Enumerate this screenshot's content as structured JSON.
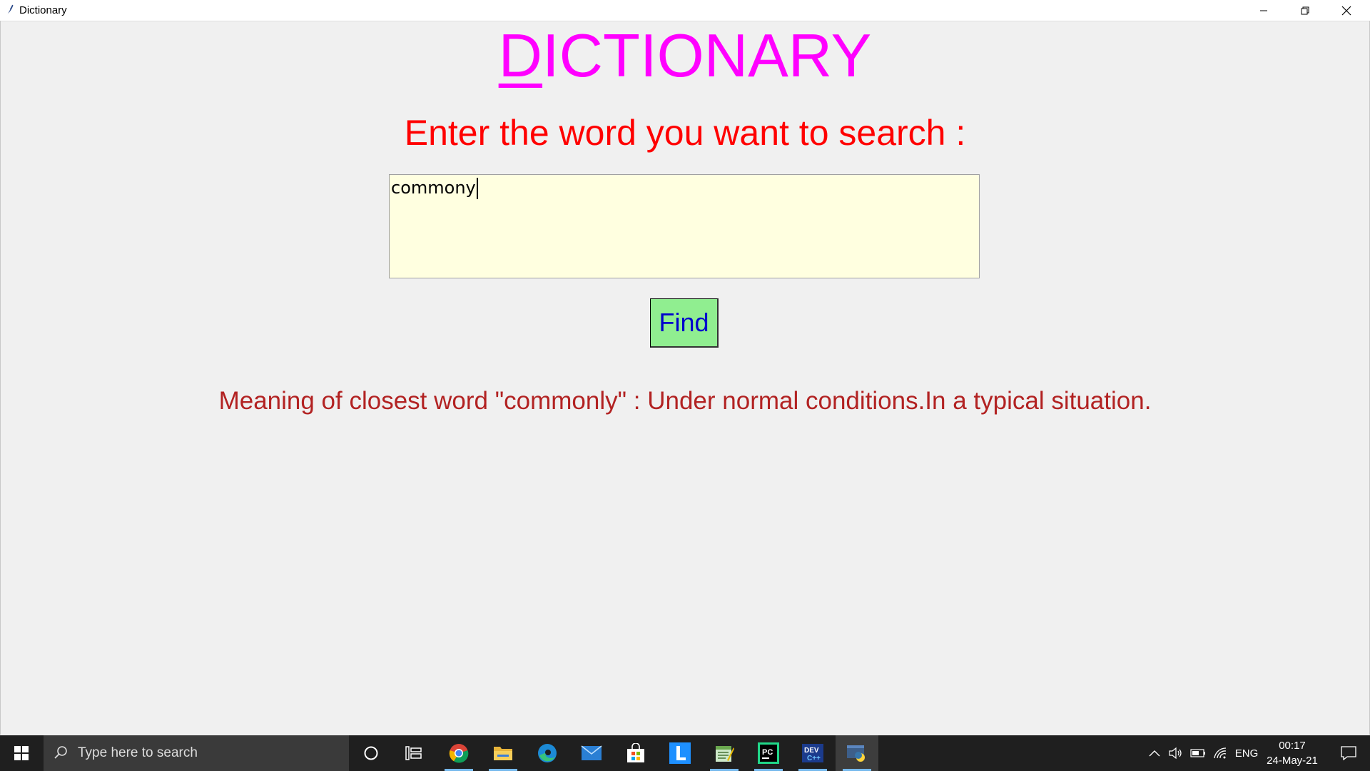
{
  "window": {
    "title": "Dictionary"
  },
  "app": {
    "heading_first_letter": "D",
    "heading_rest": "ICTIONARY",
    "prompt": "Enter the word you want to search :",
    "input_value": "commony",
    "find_label": "Find",
    "meaning_text": "Meaning of closest word \"commonly\" : Under normal conditions.In a typical situation."
  },
  "colors": {
    "heading": "#ff00ff",
    "prompt": "#ff0000",
    "input_bg": "#ffffe0",
    "button_bg": "#90ee90",
    "button_text": "#0000cd",
    "meaning": "#b22222"
  },
  "taskbar": {
    "search_placeholder": "Type here to search",
    "pinned": [
      "cortana-icon",
      "task-view-icon",
      "chrome-icon",
      "file-explorer-icon",
      "edge-icon",
      "mail-icon",
      "store-icon",
      "l-app-icon",
      "notepad-icon",
      "pycharm-icon",
      "dev-cpp-icon",
      "python-icon"
    ],
    "language": "ENG",
    "time": "00:17",
    "date": "24-May-21"
  }
}
